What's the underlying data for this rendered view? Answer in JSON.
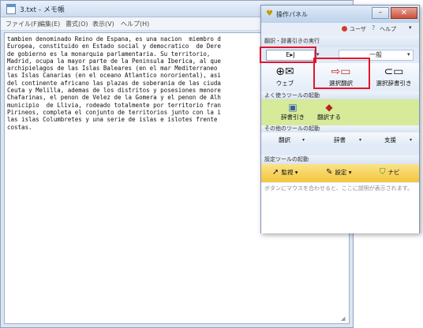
{
  "notepad": {
    "title": "3.txt - メモ帳",
    "menu": [
      "ファイル(F)",
      "編集(E)",
      "書式(O)",
      "表示(V)",
      "ヘルプ(H)"
    ],
    "text_lines": [
      "tambien denominado Reino de Espana, es una nacion  miembro d",
      "Europea, constituido en Estado social y democratico  de Dere",
      "de gobierno es la monarquia parlamentaria. Su territorio,",
      "Madrid, ocupa la mayor parte de la Peninsula Iberica, al que",
      "archipielagos de las Islas Baleares (en el mar Mediterraneo",
      "las Islas Canarias (en el oceano Atlantico nororiental), asi",
      "del continente africano las plazas de soberania de las ciuda",
      "Ceuta y Melilla, ademas de los distritos y posesiones menore",
      "Chafarinas, el penon de Velez de la Gomera y el penon de Alh",
      "municipio  de Llivia, rodeado totalmente por territorio fran",
      "Pirineos, completa el conjunto de territorios junto con la i",
      "las islas Columbretes y una serie de islas e islotes frente",
      "costas."
    ]
  },
  "panel": {
    "title": "操作パネル",
    "user_label": "ユーザ",
    "help_label": "ヘルプ",
    "options_label": "▾",
    "section_translate": "翻訳・辞書引きの実行",
    "direction": "E▸J",
    "field": "一般",
    "tools": [
      {
        "label": "ウェブ",
        "icon": "globe-mail-icon"
      },
      {
        "label": "選択翻訳",
        "icon": "select-translate-icon"
      },
      {
        "label": "選択辞書引き",
        "icon": "select-dictionary-icon"
      }
    ],
    "section_favorites": "よく使うツールの起動",
    "favorites": [
      {
        "label": "辞書引き",
        "icon": "dictionary-icon"
      },
      {
        "label": "翻訳する",
        "icon": "translate-icon"
      }
    ],
    "section_other": "その他のツールの起動",
    "other": [
      "翻訳",
      "辞書",
      "支援"
    ],
    "section_setup": "設定ツールの起動",
    "setup": [
      {
        "label": "監視",
        "icon": "monitor-icon"
      },
      {
        "label": "設定",
        "icon": "wrench-icon"
      },
      {
        "label": "ナビ",
        "icon": "navi-icon"
      }
    ],
    "description": "ボタンにマウスを合わせると、ここに説明が表示されます。"
  },
  "colors": {
    "highlight": "#e3152a",
    "favorites_bg": "#d6ea9a",
    "setup_bg": "#f3c63c"
  }
}
